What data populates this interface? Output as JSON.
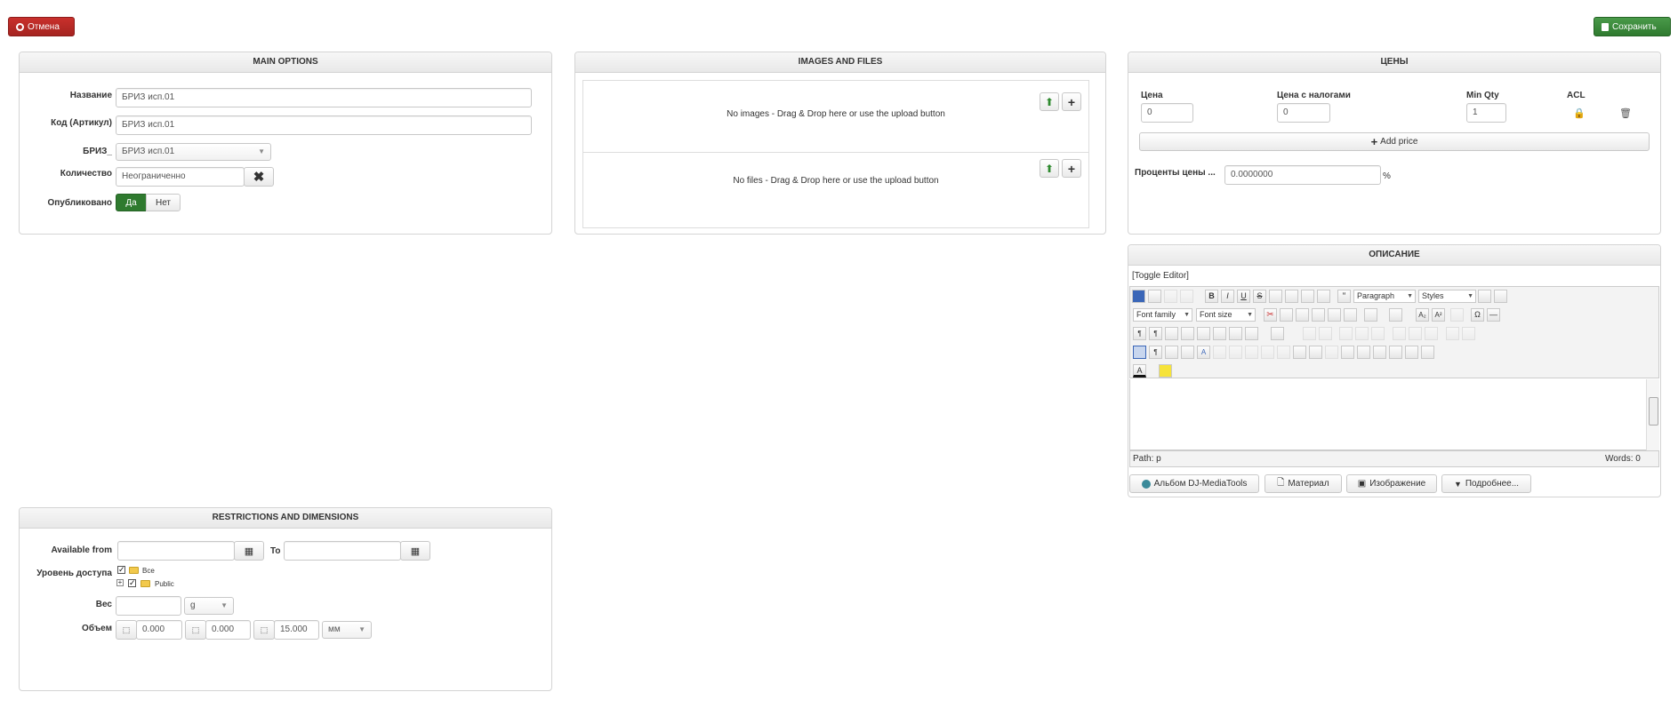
{
  "toolbar": {
    "cancel_label": "Отмена",
    "save_label": "Сохранить"
  },
  "main_options": {
    "title": "MAIN OPTIONS",
    "name_label": "Название",
    "name_value": "БРИЗ исп.01",
    "code_label": "Код (Артикул)",
    "code_value": "БРИЗ исп.01",
    "briz_label": "БРИЗ_",
    "briz_value": "БРИЗ исп.01",
    "qty_label": "Количество",
    "qty_value": "Неограниченно",
    "published_label": "Опубликовано",
    "yes_label": "Да",
    "no_label": "Нет"
  },
  "images_files": {
    "title": "IMAGES AND FILES",
    "images_text": "No images - Drag & Drop here or use the upload button",
    "files_text": "No files - Drag & Drop here or use the upload button"
  },
  "prices": {
    "title": "ЦЕНЫ",
    "col_price": "Цена",
    "col_price_tax": "Цена с налогами",
    "col_min_qty": "Min Qty",
    "col_acl": "ACL",
    "price_value": "0",
    "price_tax_value": "0",
    "min_qty_value": "1",
    "add_price_label": "Add price",
    "percent_label": "Проценты цены ...",
    "percent_value": "0.0000000",
    "percent_sign": "%"
  },
  "description": {
    "title": "ОПИСАНИЕ",
    "toggle_editor": "[Toggle Editor]",
    "format_select": "Paragraph",
    "styles_select": "Styles",
    "font_family_select": "Font family",
    "font_size_select": "Font size",
    "path_text": "Path: p",
    "words_text": "Words: 0",
    "btn_album": "Альбом DJ-MediaTools",
    "btn_material": "Материал",
    "btn_image": "Изображение",
    "btn_more": "Подробнее..."
  },
  "restrictions": {
    "title": "RESTRICTIONS AND DIMENSIONS",
    "available_from_label": "Available from",
    "to_label": "To",
    "access_label": "Уровень доступа",
    "access_all": "Все",
    "access_public": "Public",
    "weight_label": "Вес",
    "weight_unit": "g",
    "volume_label": "Объем",
    "dim1": "0.000",
    "dim2": "0.000",
    "dim3": "15.000",
    "dim_unit": "мм"
  },
  "colors": {
    "cancel": "#b52a26",
    "save": "#3a8a3a",
    "published_yes": "#2f7a2f"
  }
}
